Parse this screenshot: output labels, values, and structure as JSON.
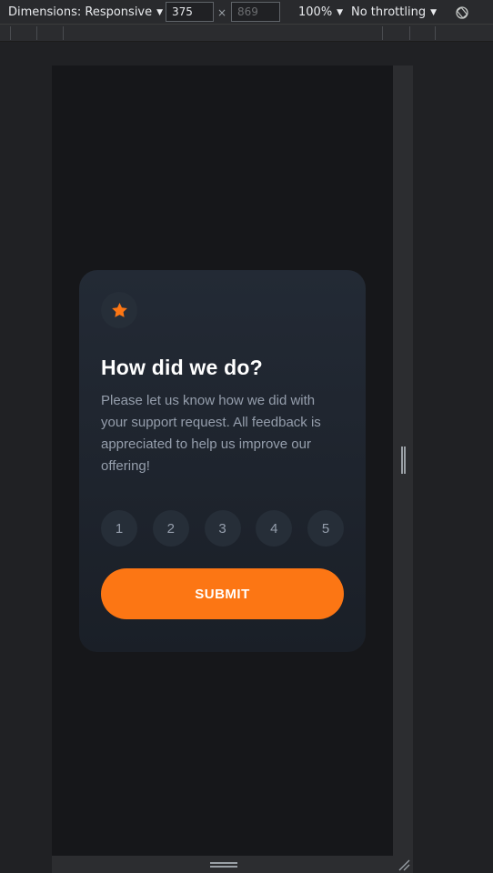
{
  "devtools": {
    "dimensions_label": "Dimensions: Responsive",
    "width_value": "375",
    "height_placeholder": "869",
    "times_symbol": "×",
    "zoom": "100%",
    "throttling": "No throttling",
    "rotate_icon": "rotate-icon"
  },
  "card": {
    "star_icon": "star-icon",
    "title": "How did we do?",
    "description": "Please let us know how we did with your support request. All feedback is appreciated to help us improve our offering!",
    "ratings": [
      "1",
      "2",
      "3",
      "4",
      "5"
    ],
    "submit_label": "SUBMIT"
  },
  "colors": {
    "accent": "#fc7614",
    "card_bg": "#232a35",
    "page_bg": "#16171a",
    "text_muted": "#959eac"
  }
}
